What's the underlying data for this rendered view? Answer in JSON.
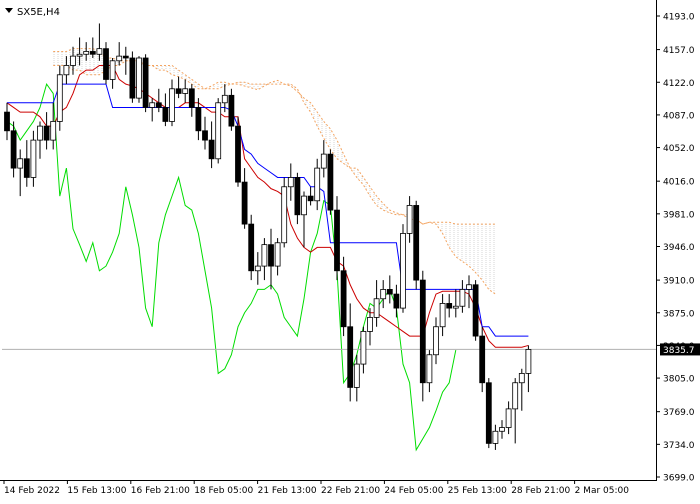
{
  "window": {
    "symbol_label": "SX5E,H4"
  },
  "chart_data": {
    "type": "candlestick",
    "y_range": [
      3699.0,
      4205.0
    ],
    "y_ticks": [
      "4193.0",
      "4157.0",
      "4122.0",
      "4087.0",
      "4052.0",
      "4016.0",
      "3981.0",
      "3946.0",
      "3910.0",
      "3875.0",
      "3840.0",
      "3805.0",
      "3769.0",
      "3734.0",
      "3699.0"
    ],
    "x_labels": [
      "14 Feb 2022",
      "15 Feb 13:00",
      "16 Feb 21:00",
      "18 Feb 05:00",
      "21 Feb 13:00",
      "22 Feb 21:00",
      "24 Feb 05:00",
      "25 Feb 13:00",
      "28 Feb 21:00",
      "2 Mar 05:00"
    ],
    "current_price": "3835.7",
    "current_value": 3835.7,
    "candles": [
      [
        4090,
        4100,
        4060,
        4070
      ],
      [
        4070,
        4080,
        4020,
        4030
      ],
      [
        4030,
        4050,
        4000,
        4040
      ],
      [
        4040,
        4060,
        4010,
        4020
      ],
      [
        4020,
        4070,
        4010,
        4060
      ],
      [
        4060,
        4080,
        4040,
        4075
      ],
      [
        4075,
        4090,
        4050,
        4060
      ],
      [
        4060,
        4100,
        4050,
        4080
      ],
      [
        4080,
        4140,
        4070,
        4130
      ],
      [
        4130,
        4150,
        4120,
        4140
      ],
      [
        4140,
        4160,
        4130,
        4150
      ],
      [
        4150,
        4170,
        4140,
        4152
      ],
      [
        4152,
        4165,
        4145,
        4155
      ],
      [
        4155,
        4170,
        4148,
        4152
      ],
      [
        4152,
        4185,
        4145,
        4158
      ],
      [
        4158,
        4165,
        4120,
        4125
      ],
      [
        4125,
        4148,
        4115,
        4145
      ],
      [
        4145,
        4165,
        4140,
        4150
      ],
      [
        4150,
        4160,
        4130,
        4148
      ],
      [
        4148,
        4155,
        4100,
        4105
      ],
      [
        4105,
        4150,
        4100,
        4148
      ],
      [
        4148,
        4152,
        4090,
        4095
      ],
      [
        4095,
        4105,
        4080,
        4100
      ],
      [
        4100,
        4115,
        4090,
        4095
      ],
      [
        4095,
        4110,
        4075,
        4080
      ],
      [
        4080,
        4125,
        4075,
        4115
      ],
      [
        4115,
        4128,
        4105,
        4110
      ],
      [
        4110,
        4125,
        4100,
        4115
      ],
      [
        4115,
        4120,
        4085,
        4095
      ],
      [
        4095,
        4105,
        4060,
        4070
      ],
      [
        4070,
        4085,
        4050,
        4060
      ],
      [
        4060,
        4080,
        4030,
        4040
      ],
      [
        4040,
        4105,
        4035,
        4100
      ],
      [
        4100,
        4120,
        4090,
        4108
      ],
      [
        4108,
        4115,
        4070,
        4075
      ],
      [
        4075,
        4085,
        4010,
        4015
      ],
      [
        4015,
        4030,
        3965,
        3970
      ],
      [
        3970,
        3980,
        3910,
        3920
      ],
      [
        3920,
        3940,
        3905,
        3925
      ],
      [
        3925,
        3955,
        3910,
        3948
      ],
      [
        3948,
        3965,
        3900,
        3925
      ],
      [
        3925,
        3955,
        3915,
        3950
      ],
      [
        3950,
        4020,
        3945,
        4010
      ],
      [
        4010,
        4035,
        3995,
        4020
      ],
      [
        4020,
        4025,
        3970,
        3980
      ],
      [
        3980,
        4005,
        3945,
        4000
      ],
      [
        4000,
        4010,
        3990,
        3995
      ],
      [
        3995,
        4040,
        3985,
        4030
      ],
      [
        4030,
        4060,
        4020,
        4045
      ],
      [
        4045,
        4050,
        3980,
        3985
      ],
      [
        3985,
        4000,
        3910,
        3920
      ],
      [
        3920,
        3935,
        3850,
        3860
      ],
      [
        3860,
        3885,
        3780,
        3795
      ],
      [
        3795,
        3830,
        3780,
        3820
      ],
      [
        3820,
        3860,
        3810,
        3855
      ],
      [
        3855,
        3880,
        3840,
        3870
      ],
      [
        3870,
        3910,
        3860,
        3890
      ],
      [
        3890,
        3910,
        3880,
        3900
      ],
      [
        3900,
        3915,
        3885,
        3895
      ],
      [
        3895,
        3905,
        3870,
        3880
      ],
      [
        3880,
        3970,
        3875,
        3960
      ],
      [
        3960,
        4000,
        3950,
        3990
      ],
      [
        3990,
        3995,
        3900,
        3910
      ],
      [
        3910,
        3920,
        3780,
        3800
      ],
      [
        3800,
        3835,
        3790,
        3830
      ],
      [
        3830,
        3870,
        3820,
        3860
      ],
      [
        3860,
        3895,
        3850,
        3885
      ],
      [
        3885,
        3895,
        3870,
        3880
      ],
      [
        3880,
        3900,
        3870,
        3882
      ],
      [
        3882,
        3910,
        3875,
        3900
      ],
      [
        3900,
        3915,
        3880,
        3905
      ],
      [
        3905,
        3910,
        3845,
        3850
      ],
      [
        3850,
        3860,
        3790,
        3800
      ],
      [
        3800,
        3805,
        3730,
        3735
      ],
      [
        3735,
        3755,
        3728,
        3748
      ],
      [
        3748,
        3760,
        3740,
        3752
      ],
      [
        3752,
        3780,
        3745,
        3772
      ],
      [
        3772,
        3805,
        3735,
        3800
      ],
      [
        3800,
        3815,
        3770,
        3810
      ],
      [
        3810,
        3840,
        3790,
        3835.7
      ]
    ],
    "tenkan": [
      4100,
      4100,
      4100,
      4100,
      4100,
      4100,
      4100,
      4100,
      4120,
      4120,
      4120,
      4120,
      4120,
      4120,
      4120,
      4120,
      4095,
      4095,
      4095,
      4095,
      4095,
      4095,
      4095,
      4095,
      4095,
      4095,
      4095,
      4095,
      4095,
      4095,
      4095,
      4095,
      4095,
      4095,
      4092,
      4075,
      4050,
      4045,
      4035,
      4030,
      4025,
      4020,
      4020,
      4020,
      4020,
      4020,
      4010,
      4010,
      4005,
      3950,
      3950,
      3950,
      3950,
      3950,
      3950,
      3950,
      3950,
      3950,
      3950,
      3950,
      3900,
      3900,
      3900,
      3900,
      3900,
      3900,
      3900,
      3900,
      3900,
      3900,
      3900,
      3900,
      3860,
      3860,
      3850,
      3850,
      3850,
      3850,
      3850,
      3850
    ],
    "kijun": [
      4100,
      4095,
      4090,
      4090,
      4090,
      4085,
      4075,
      4075,
      4090,
      4095,
      4110,
      4130,
      4135,
      4135,
      4140,
      4140,
      4140,
      4125,
      4120,
      4118,
      4115,
      4110,
      4105,
      4100,
      4095,
      4095,
      4095,
      4100,
      4100,
      4100,
      4095,
      4090,
      4090,
      4085,
      4085,
      4085,
      4040,
      4030,
      4020,
      4015,
      4008,
      4005,
      4000,
      3970,
      3955,
      3945,
      3940,
      3945,
      3945,
      3945,
      3930,
      3925,
      3905,
      3890,
      3880,
      3875,
      3875,
      3870,
      3865,
      3860,
      3855,
      3850,
      3850,
      3850,
      3875,
      3895,
      3898,
      3898,
      3898,
      3898,
      3895,
      3880,
      3860,
      3845,
      3838,
      3838,
      3838,
      3838,
      3838,
      3840
    ],
    "senkou_a": [
      4140,
      4140,
      4140,
      4135,
      4135,
      4130,
      4130,
      4130,
      4135,
      4140,
      4140,
      4145,
      4145,
      4145,
      4140,
      4140,
      4135,
      4135,
      4130,
      4128,
      4125,
      4120,
      4115,
      4115,
      4118,
      4122,
      4122,
      4120,
      4120,
      4118,
      4116,
      4114,
      4118,
      4122,
      4124,
      4120,
      4118,
      4112,
      4105,
      4100,
      4090,
      4080,
      4072,
      4060,
      4045,
      4030,
      4020,
      4012,
      4000,
      3990,
      3985,
      3982,
      3980,
      3980,
      3980,
      3975,
      3970,
      3972,
      3970,
      3960,
      3945,
      3935,
      3930,
      3925,
      3918,
      3910,
      3900,
      3895
    ],
    "senkou_b": [
      4155,
      4155,
      4155,
      4158,
      4158,
      4158,
      4158,
      4155,
      4148,
      4148,
      4145,
      4145,
      4145,
      4142,
      4140,
      4140,
      4140,
      4140,
      4140,
      4135,
      4130,
      4125,
      4120,
      4115,
      4115,
      4115,
      4118,
      4120,
      4122,
      4122,
      4120,
      4120,
      4120,
      4120,
      4120,
      4120,
      4120,
      4115,
      4100,
      4090,
      4075,
      4062,
      4050,
      4040,
      4035,
      4030,
      4030,
      4020,
      4010,
      4000,
      3992,
      3985,
      3982,
      3980,
      3975,
      3975,
      3970,
      3972,
      3972,
      3972,
      3972,
      3970,
      3970,
      3970,
      3970,
      3970,
      3970,
      3970
    ],
    "chikou": [
      4080,
      4075,
      4060,
      4070,
      4080,
      4095,
      4120,
      4110,
      4000,
      4030,
      3965,
      3948,
      3930,
      3950,
      3920,
      3925,
      3940,
      3960,
      4010,
      3980,
      3945,
      3880,
      3860,
      3950,
      3980,
      4000,
      4020,
      3990,
      3985,
      3960,
      3920,
      3880,
      3810,
      3815,
      3830,
      3860,
      3875,
      3885,
      3900,
      3900,
      3905,
      3895,
      3870,
      3860,
      3850,
      3890,
      3940,
      3960,
      3995,
      3990,
      3920,
      3800,
      3810,
      3830,
      3860,
      3885,
      3880,
      3890,
      3900,
      3880,
      3820,
      3800,
      3728,
      3740,
      3752,
      3770,
      3790,
      3800,
      3835
    ]
  },
  "colors": {
    "candle_up": "#ffffff",
    "candle_down": "#000000",
    "candle_outline": "#000000",
    "tenkan": "#0000ff",
    "kijun": "#cc0000",
    "chikou": "#00dd00",
    "cloud_outline": "#f4a460",
    "cloud_hatch": "#bbbbbb",
    "current_price_line": "#b0b0b0",
    "price_tag_bg": "#000000",
    "price_tag_text": "#ffffff",
    "axis": "#000000"
  },
  "icons": {
    "symbol_menu": "triangle-down-icon"
  }
}
